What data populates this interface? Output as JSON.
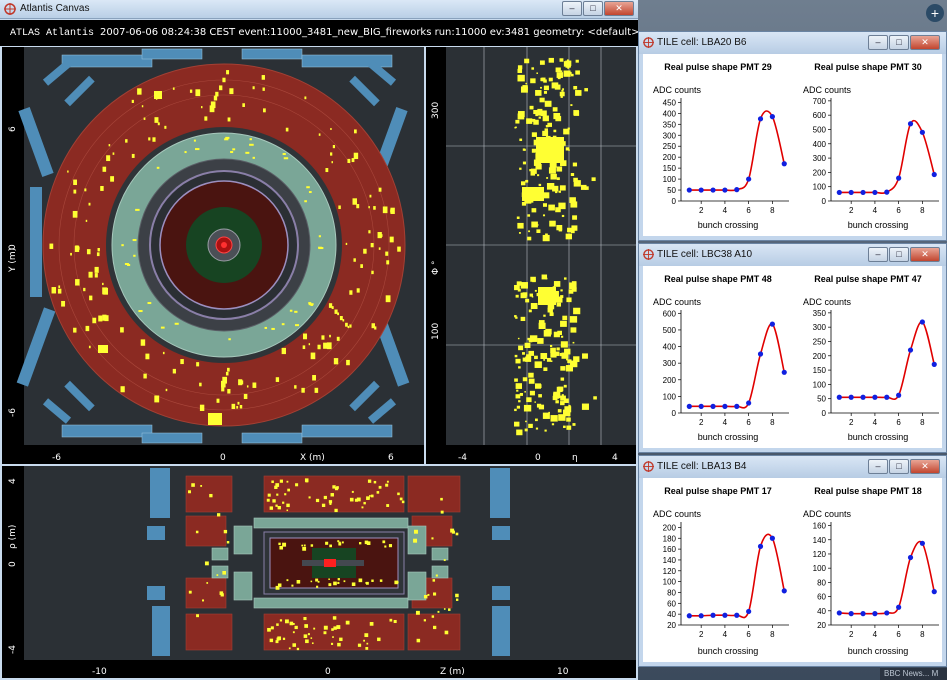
{
  "main_window": {
    "title": "Atlantis Canvas",
    "header_brand": "ATLAS Atlantis",
    "header_info": "2007-06-06 08:24:38 CEST  event:11000_3481_new_BIG_fireworks run:11000 ev:3481  geometry: <default>",
    "controls": {
      "minimize": "–",
      "maximize": "□",
      "close": "✕"
    }
  },
  "yx_view": {
    "y_axis_label": "Y (m)",
    "x_axis_label": "X (m)",
    "x_ticks": [
      "-6",
      "0",
      "6"
    ],
    "y_ticks": [
      "6",
      "0",
      "-6"
    ]
  },
  "phi_eta_view": {
    "y_axis_label": "Φ °",
    "x_axis_label": "η",
    "x_ticks": [
      "-4",
      "0",
      "4"
    ],
    "y_ticks": [
      "300",
      "100"
    ]
  },
  "rz_view": {
    "y_axis_label": "ρ (m)",
    "x_axis_label": "Z (m)",
    "x_ticks": [
      "-10",
      "0",
      "10"
    ],
    "y_ticks": [
      "4",
      "0",
      "-4"
    ]
  },
  "tile_windows": [
    {
      "title": "TILE cell: LBA20 B6",
      "plots": [
        {
          "title": "Real pulse shape PMT 29",
          "ylabel": "ADC counts",
          "xlabel": "bunch crossing",
          "yticks": [
            "0",
            "50",
            "100",
            "150",
            "200",
            "250",
            "300",
            "350",
            "400",
            "450"
          ],
          "ymax": 470,
          "xticks": [
            "2",
            "4",
            "6",
            "8"
          ],
          "points": [
            [
              1,
              50
            ],
            [
              2,
              50
            ],
            [
              3,
              50
            ],
            [
              4,
              50
            ],
            [
              5,
              52
            ],
            [
              6,
              100
            ],
            [
              7,
              375
            ],
            [
              8,
              385
            ],
            [
              9,
              170
            ]
          ]
        },
        {
          "title": "Real pulse shape PMT 30",
          "ylabel": "ADC counts",
          "xlabel": "bunch crossing",
          "yticks": [
            "0",
            "100",
            "200",
            "300",
            "400",
            "500",
            "600",
            "700"
          ],
          "ymax": 720,
          "xticks": [
            "2",
            "4",
            "6",
            "8"
          ],
          "points": [
            [
              1,
              60
            ],
            [
              2,
              60
            ],
            [
              3,
              60
            ],
            [
              4,
              60
            ],
            [
              5,
              62
            ],
            [
              6,
              160
            ],
            [
              7,
              540
            ],
            [
              8,
              480
            ],
            [
              9,
              185
            ]
          ]
        }
      ]
    },
    {
      "title": "TILE cell: LBC38 A10",
      "plots": [
        {
          "title": "Real pulse shape PMT 48",
          "ylabel": "ADC counts",
          "xlabel": "bunch crossing",
          "yticks": [
            "0",
            "100",
            "200",
            "300",
            "400",
            "500",
            "600"
          ],
          "ymax": 620,
          "xticks": [
            "2",
            "4",
            "6",
            "8"
          ],
          "points": [
            [
              1,
              40
            ],
            [
              2,
              40
            ],
            [
              3,
              40
            ],
            [
              4,
              40
            ],
            [
              5,
              40
            ],
            [
              6,
              60
            ],
            [
              7,
              355
            ],
            [
              8,
              535
            ],
            [
              9,
              245
            ]
          ]
        },
        {
          "title": "Real pulse shape PMT 47",
          "ylabel": "ADC counts",
          "xlabel": "bunch crossing",
          "yticks": [
            "0",
            "50",
            "100",
            "150",
            "200",
            "250",
            "300",
            "350"
          ],
          "ymax": 360,
          "xticks": [
            "2",
            "4",
            "6",
            "8"
          ],
          "points": [
            [
              1,
              55
            ],
            [
              2,
              55
            ],
            [
              3,
              55
            ],
            [
              4,
              55
            ],
            [
              5,
              55
            ],
            [
              6,
              62
            ],
            [
              7,
              220
            ],
            [
              8,
              318
            ],
            [
              9,
              170
            ]
          ]
        }
      ]
    },
    {
      "title": "TILE cell: LBA13 B4",
      "plots": [
        {
          "title": "Real pulse shape PMT 17",
          "ylabel": "ADC counts",
          "xlabel": "bunch crossing",
          "yticks": [
            "20",
            "40",
            "60",
            "80",
            "100",
            "120",
            "140",
            "160",
            "180",
            "200"
          ],
          "ymin": 20,
          "ymax": 210,
          "xticks": [
            "2",
            "4",
            "6",
            "8"
          ],
          "points": [
            [
              1,
              37
            ],
            [
              2,
              37
            ],
            [
              3,
              38
            ],
            [
              4,
              38
            ],
            [
              5,
              38
            ],
            [
              6,
              45
            ],
            [
              7,
              165
            ],
            [
              8,
              180
            ],
            [
              9,
              83
            ]
          ]
        },
        {
          "title": "Real pulse shape PMT 18",
          "ylabel": "ADC counts",
          "xlabel": "bunch crossing",
          "yticks": [
            "20",
            "40",
            "60",
            "80",
            "100",
            "120",
            "140",
            "160"
          ],
          "ymin": 20,
          "ymax": 165,
          "xticks": [
            "2",
            "4",
            "6",
            "8"
          ],
          "points": [
            [
              1,
              37
            ],
            [
              2,
              36
            ],
            [
              3,
              36
            ],
            [
              4,
              36
            ],
            [
              5,
              37
            ],
            [
              6,
              45
            ],
            [
              7,
              115
            ],
            [
              8,
              135
            ],
            [
              9,
              67
            ]
          ]
        }
      ]
    }
  ],
  "taskbar": {
    "news": "BBC News... M"
  }
}
